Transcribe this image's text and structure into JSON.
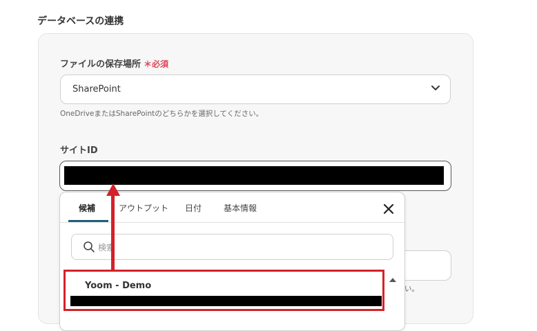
{
  "section_title": "データベースの連携",
  "storage": {
    "label": "ファイルの保存場所",
    "required": "＊必須",
    "value": "SharePoint",
    "hint": "OneDriveまたはSharePointのどちらかを選択してください。"
  },
  "site_id": {
    "label": "サイトID"
  },
  "background_hint": "い。",
  "dropdown": {
    "tabs": [
      "候補",
      "アウトプット",
      "日付",
      "基本情報"
    ],
    "active_tab": "候補",
    "search_placeholder": "検索",
    "option_title": "Yoom - Demo"
  },
  "colors": {
    "accent_red": "#d4212a",
    "tab_underline": "#1f5f7a",
    "required_red": "#e0445a"
  },
  "icons": [
    "chevron-down-icon",
    "close-icon",
    "search-icon",
    "scroll-up-icon",
    "arrow-up-icon"
  ]
}
